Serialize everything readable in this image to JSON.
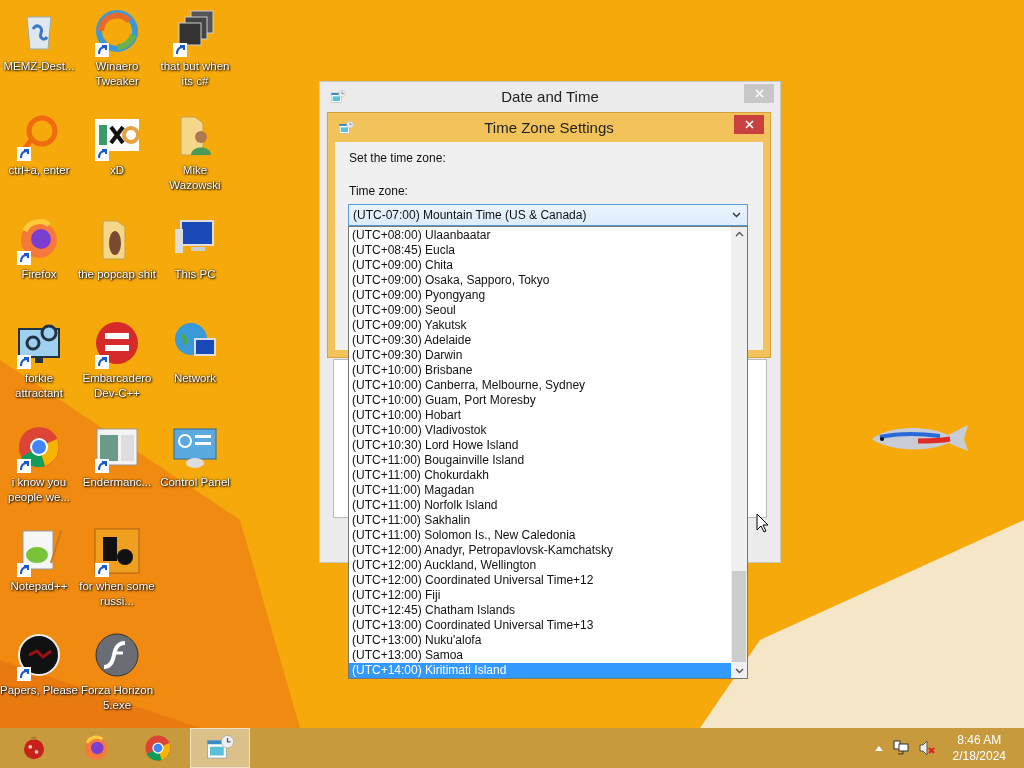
{
  "desktop_rows": [
    [
      {
        "label": "MEMZ-Dest...",
        "kind": "bin",
        "shortcut": false
      },
      {
        "label": "Winaero Tweaker",
        "kind": "swirl",
        "shortcut": true
      },
      {
        "label": "that but when its c#",
        "kind": "stack",
        "shortcut": true
      }
    ],
    [
      {
        "label": "ctrl+a, enter",
        "kind": "ring",
        "shortcut": true
      },
      {
        "label": "xD",
        "kind": "hex",
        "shortcut": true
      },
      {
        "label": "Mike Wazowski",
        "kind": "userfolder",
        "shortcut": false
      }
    ],
    [
      {
        "label": "Firefox",
        "kind": "firefox",
        "shortcut": true
      },
      {
        "label": "the popcap shit",
        "kind": "folder",
        "shortcut": false
      },
      {
        "label": "This PC",
        "kind": "pc",
        "shortcut": false
      }
    ],
    [
      {
        "label": "forkie attractant",
        "kind": "gears",
        "shortcut": true
      },
      {
        "label": "Embarcadero Dev-C++",
        "kind": "dev",
        "shortcut": true
      },
      {
        "label": "Network",
        "kind": "globe",
        "shortcut": false
      }
    ],
    [
      {
        "label": "i know you people we...",
        "kind": "chrome",
        "shortcut": true
      },
      {
        "label": "Endermanc...",
        "kind": "window",
        "shortcut": true
      },
      {
        "label": "Control Panel",
        "kind": "panel",
        "shortcut": false
      }
    ],
    [
      {
        "label": "Notepad++",
        "kind": "notepad",
        "shortcut": true
      },
      {
        "label": "for when some russi...",
        "kind": "tile",
        "shortcut": true
      }
    ],
    [
      {
        "label": "Papers, Please",
        "kind": "dark",
        "shortcut": true
      },
      {
        "label": "Forza Horizon 5.exe",
        "kind": "flash",
        "shortcut": false
      }
    ]
  ],
  "date_time_window": {
    "title": "Date and Time"
  },
  "time_zone_window": {
    "title": "Time Zone Settings",
    "prompt": "Set the time zone:",
    "field_label": "Time zone:",
    "value": "(UTC-07:00) Mountain Time (US & Canada)",
    "options": [
      {
        "label": "(UTC+08:00) Ulaanbaatar",
        "selected": false
      },
      {
        "label": "(UTC+08:45) Eucla",
        "selected": false
      },
      {
        "label": "(UTC+09:00) Chita",
        "selected": false
      },
      {
        "label": "(UTC+09:00) Osaka, Sapporo, Tokyo",
        "selected": false
      },
      {
        "label": "(UTC+09:00) Pyongyang",
        "selected": false
      },
      {
        "label": "(UTC+09:00) Seoul",
        "selected": false
      },
      {
        "label": "(UTC+09:00) Yakutsk",
        "selected": false
      },
      {
        "label": "(UTC+09:30) Adelaide",
        "selected": false
      },
      {
        "label": "(UTC+09:30) Darwin",
        "selected": false
      },
      {
        "label": "(UTC+10:00) Brisbane",
        "selected": false
      },
      {
        "label": "(UTC+10:00) Canberra, Melbourne, Sydney",
        "selected": false
      },
      {
        "label": "(UTC+10:00) Guam, Port Moresby",
        "selected": false
      },
      {
        "label": "(UTC+10:00) Hobart",
        "selected": false
      },
      {
        "label": "(UTC+10:00) Vladivostok",
        "selected": false
      },
      {
        "label": "(UTC+10:30) Lord Howe Island",
        "selected": false
      },
      {
        "label": "(UTC+11:00) Bougainville Island",
        "selected": false
      },
      {
        "label": "(UTC+11:00) Chokurdakh",
        "selected": false
      },
      {
        "label": "(UTC+11:00) Magadan",
        "selected": false
      },
      {
        "label": "(UTC+11:00) Norfolk Island",
        "selected": false
      },
      {
        "label": "(UTC+11:00) Sakhalin",
        "selected": false
      },
      {
        "label": "(UTC+11:00) Solomon Is., New Caledonia",
        "selected": false
      },
      {
        "label": "(UTC+12:00) Anadyr, Petropavlovsk-Kamchatsky",
        "selected": false
      },
      {
        "label": "(UTC+12:00) Auckland, Wellington",
        "selected": false
      },
      {
        "label": "(UTC+12:00) Coordinated Universal Time+12",
        "selected": false
      },
      {
        "label": "(UTC+12:00) Fiji",
        "selected": false
      },
      {
        "label": "(UTC+12:45) Chatham Islands",
        "selected": false
      },
      {
        "label": "(UTC+13:00) Coordinated Universal Time+13",
        "selected": false
      },
      {
        "label": "(UTC+13:00) Nuku'alofa",
        "selected": false
      },
      {
        "label": "(UTC+13:00) Samoa",
        "selected": false
      },
      {
        "label": "(UTC+14:00) Kiritimati Island",
        "selected": true
      }
    ]
  },
  "taskbar": {
    "apps": [
      {
        "kind": "ornament",
        "selected": false
      },
      {
        "kind": "firefox",
        "selected": false
      },
      {
        "kind": "chrome",
        "selected": false
      },
      {
        "kind": "calendar",
        "selected": true
      }
    ],
    "time": "8:46 AM",
    "date": "2/18/2024"
  }
}
